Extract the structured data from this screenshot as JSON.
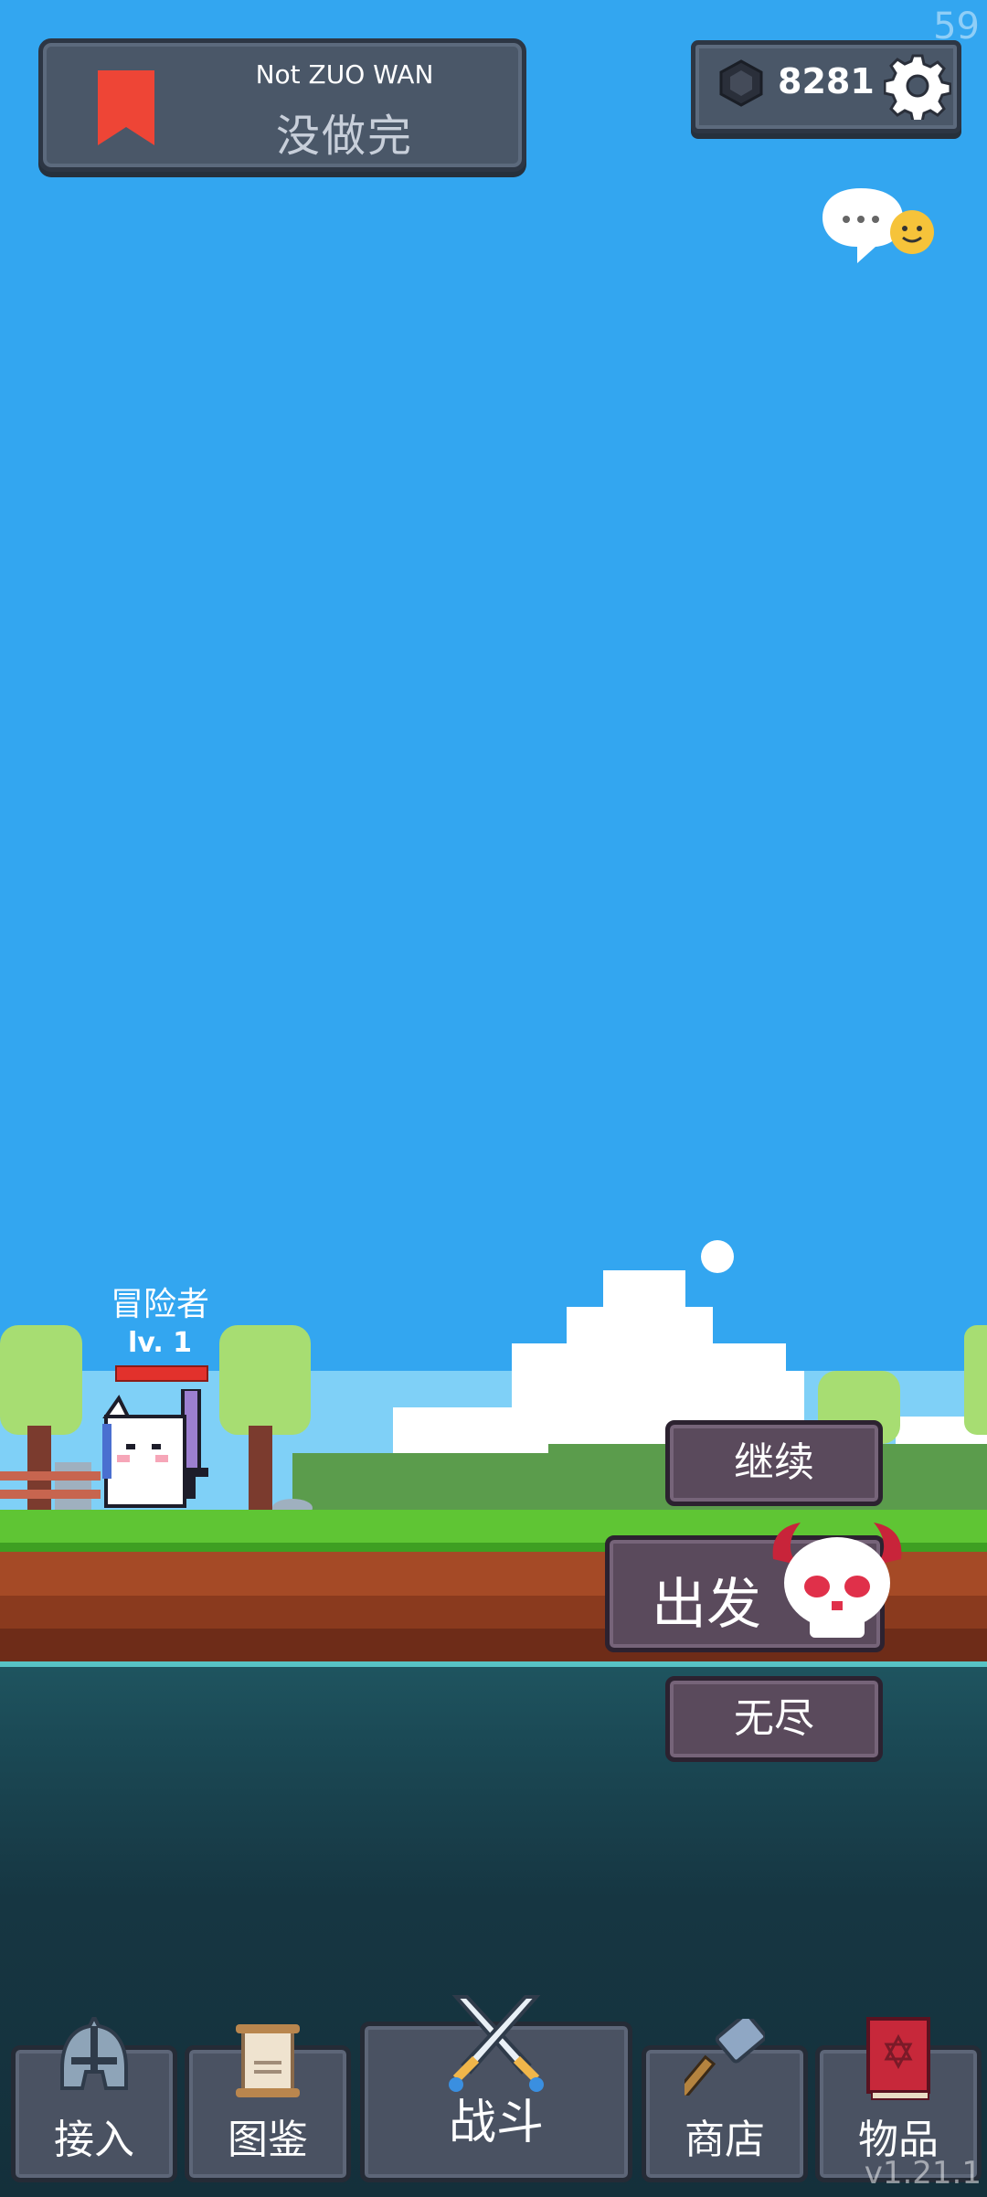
{
  "status": {
    "fps": "59",
    "version": "v1.21.1"
  },
  "title_panel": {
    "subtitle": "Not ZUO WAN",
    "title": "没做完"
  },
  "currency": {
    "value": "8281"
  },
  "player": {
    "name": "冒险者",
    "level": "lv. 1",
    "hp_fraction": 1.0
  },
  "actions": {
    "continue_label": "继续",
    "go_label": "出发",
    "endless_label": "无尽"
  },
  "nav": {
    "tabs": [
      {
        "label": "接入",
        "icon": "helmet-icon"
      },
      {
        "label": "图鉴",
        "icon": "scroll-icon"
      },
      {
        "label": "战斗",
        "icon": "crossed-swords-icon"
      },
      {
        "label": "商店",
        "icon": "hammer-icon"
      },
      {
        "label": "物品",
        "icon": "spellbook-icon"
      }
    ]
  },
  "colors": {
    "sky": "#33a6f0",
    "panel": "#4a5768",
    "button": "#5a4a5c",
    "accent_red": "#e5423a"
  }
}
